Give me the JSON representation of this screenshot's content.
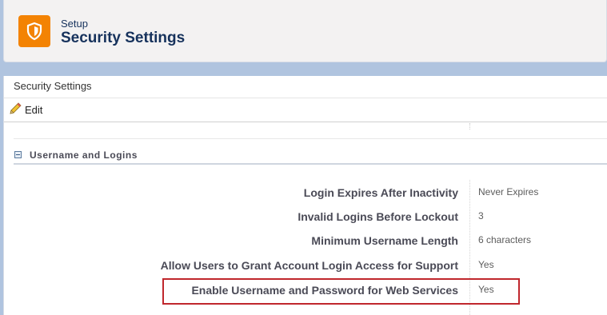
{
  "header": {
    "supertitle": "Setup",
    "title": "Security Settings",
    "icon": "shield-icon",
    "icon_color": "#f38303"
  },
  "page": {
    "title": "Security Settings",
    "edit_label": "Edit"
  },
  "section": {
    "title": "Username and Logins",
    "rows": [
      {
        "label": "Login Expires After Inactivity",
        "value": "Never Expires",
        "highlighted": false
      },
      {
        "label": "Invalid Logins Before Lockout",
        "value": "3",
        "highlighted": false
      },
      {
        "label": "Minimum Username Length",
        "value": "6 characters",
        "highlighted": false
      },
      {
        "label": "Allow Users to Grant Account Login Access for Support",
        "value": "Yes",
        "highlighted": false
      },
      {
        "label": "Enable Username and Password for Web Services",
        "value": "Yes",
        "highlighted": true
      }
    ]
  },
  "colors": {
    "background": "#b0c4df",
    "highlight_border": "#c0272d",
    "title_text": "#16325c"
  }
}
